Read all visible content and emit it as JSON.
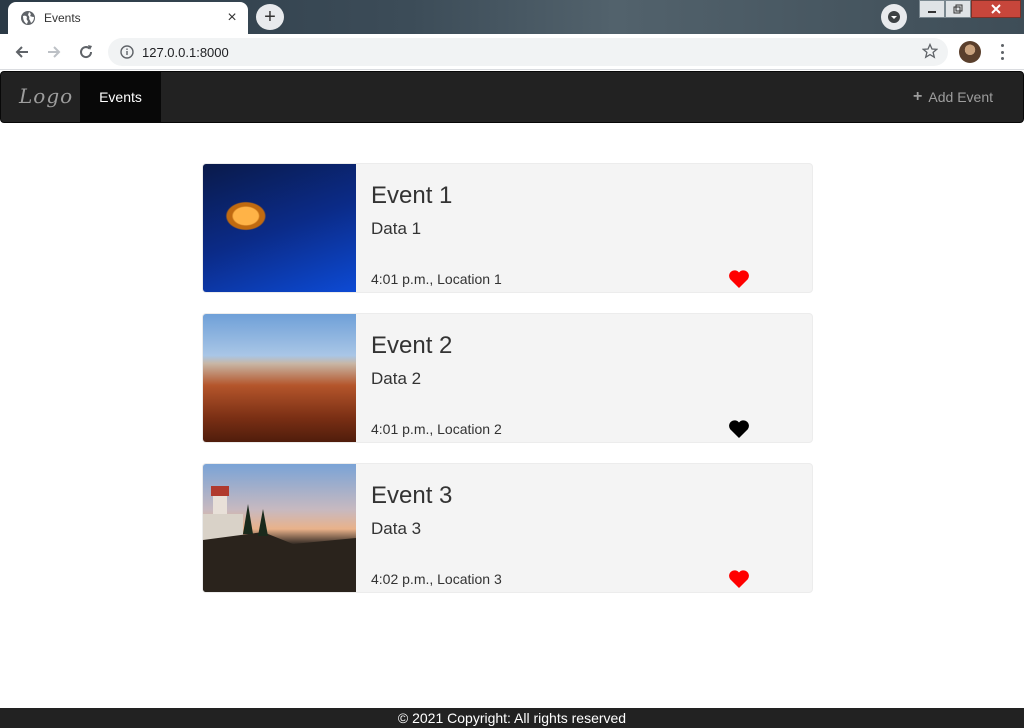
{
  "browser": {
    "tab_title": "Events",
    "tab_close": "×",
    "new_tab": "+",
    "url": "127.0.0.1:8000"
  },
  "navbar": {
    "brand": "Logo",
    "active_item": "Events",
    "add_event_icon": "+",
    "add_event_label": "Add Event"
  },
  "events": [
    {
      "title": "Event 1",
      "data": "Data 1",
      "meta": "4:01 p.m., Location 1",
      "image": "jellyfish",
      "liked": true
    },
    {
      "title": "Event 2",
      "data": "Data 2",
      "meta": "4:01 p.m., Location 2",
      "image": "desert-butte",
      "liked": false
    },
    {
      "title": "Event 3",
      "data": "Data 3",
      "meta": "4:02 p.m., Location 3",
      "image": "lighthouse",
      "liked": true
    }
  ],
  "footer": {
    "text": "© 2021 Copyright: All rights reserved"
  },
  "colors": {
    "navbar": "#222222",
    "heart_liked": "#ff0000",
    "heart_unliked": "#000000",
    "card_bg": "#f4f4f4"
  },
  "icons": [
    "globe-icon",
    "close-icon",
    "plus-icon",
    "back-icon",
    "forward-icon",
    "reload-icon",
    "info-icon",
    "star-icon",
    "heart-icon"
  ]
}
